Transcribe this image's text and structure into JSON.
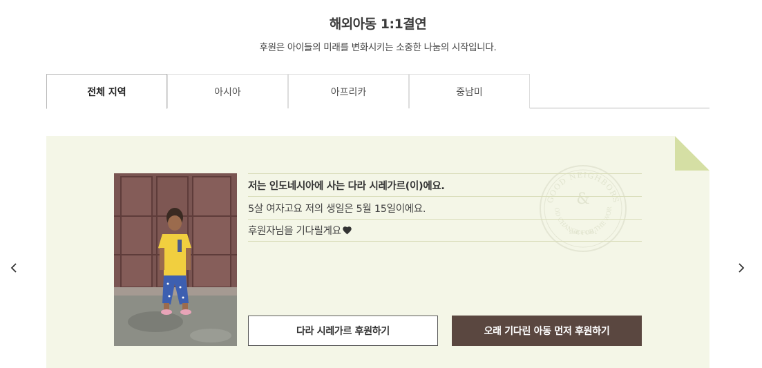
{
  "header": {
    "title": "해외아동 1:1결연",
    "subtitle": "후원은 아이들의 미래를 변화시키는 소중한 나눔의 시작입니다."
  },
  "tabs": [
    {
      "label": "전체 지역",
      "active": true
    },
    {
      "label": "아시아",
      "active": false
    },
    {
      "label": "아프리카",
      "active": false
    },
    {
      "label": "중남미",
      "active": false
    }
  ],
  "child": {
    "intro": "저는 인도네시아에 사는 다라 시레가르(이)에요.",
    "details": "5살 여자고요 저의 생일은 5월 15일이에요.",
    "message": "후원자님을 기다릴게요",
    "heart_icon": "heart-icon"
  },
  "stamp": {
    "top_text": "GOOD NEIGHBORS",
    "middle_text": "GOOD CHANGE FOR THE WORLD",
    "year_text": "SINCE 1991"
  },
  "buttons": {
    "sponsor_child": "다라 시레가르 후원하기",
    "sponsor_waiting": "오래 기다린 아동 먼저 후원하기"
  },
  "colors": {
    "card_bg": "#f4f6e7",
    "fold": "#d5dfa4",
    "dark_button": "#5a4740",
    "line": "#d8dcb8"
  },
  "nav": {
    "prev_icon": "chevron-left-icon",
    "next_icon": "chevron-right-icon"
  }
}
